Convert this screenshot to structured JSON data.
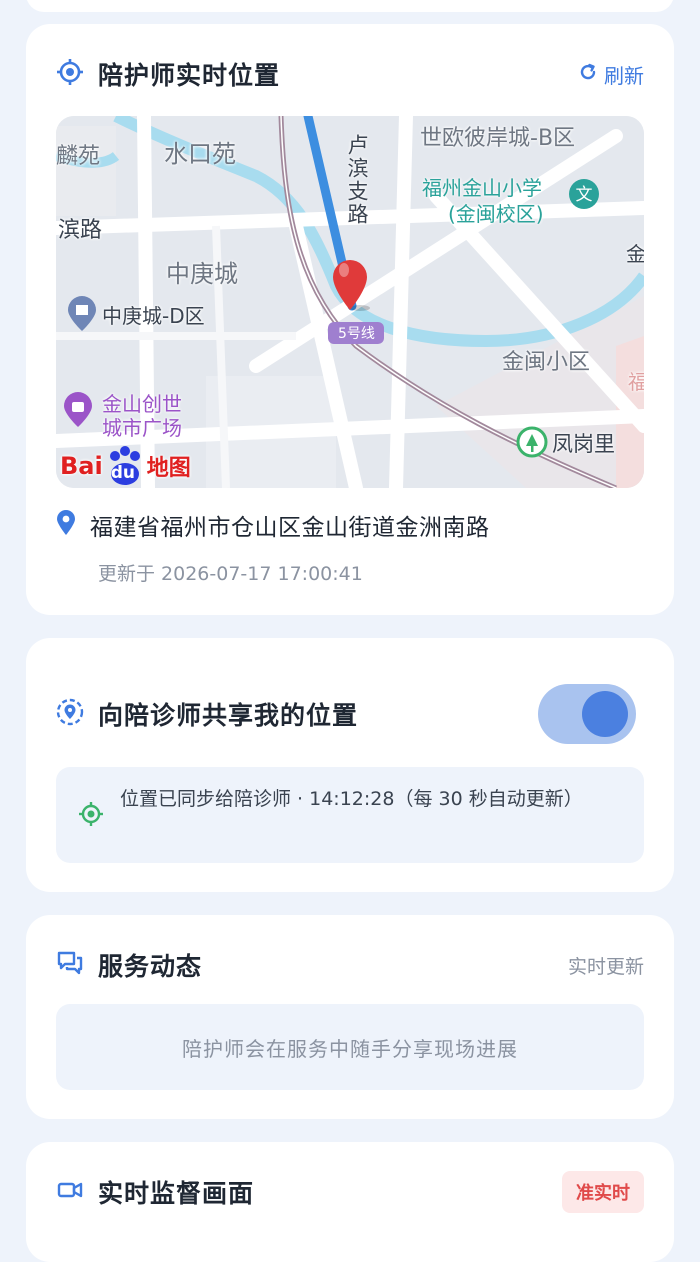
{
  "location_card": {
    "title": "陪护师实时位置",
    "refresh_label": "刷新",
    "map": {
      "labels": {
        "shuikouyuan": "水口苑",
        "linyuan": "麟苑",
        "binlu": "滨路",
        "shiou": "世欧彼岸城-B区",
        "school_1": "福州金山小学",
        "school_2": "(金闽校区)",
        "luzhi_road": "卢滨支路",
        "zhonggengcheng": "中庚城",
        "zhonggeng_d": "中庚城-D区",
        "jinmin": "金闽小区",
        "mall_1": "金山创世",
        "mall_2": "城市广场",
        "fenggangli": "凤岗里",
        "line5": "5号线",
        "edge_jin": "金",
        "edge_fu": "福"
      },
      "logo_text": "Bai",
      "logo_du": "du",
      "logo_suffix": "地图"
    },
    "address": "福建省福州市仓山区金山街道金洲南路",
    "updated": "更新于 2026-07-17 17:00:41"
  },
  "share_card": {
    "title": "向陪诊师共享我的位置",
    "toggle_on": true,
    "notice": "位置已同步给陪诊师 · 14:12:28（每 30 秒自动更新）"
  },
  "service_card": {
    "title": "服务动态",
    "status": "实时更新",
    "empty_text": "陪护师会在服务中随手分享现场进展"
  },
  "monitor_card": {
    "title": "实时监督画面",
    "badge": "准实时"
  },
  "colors": {
    "accent": "#3f7be0",
    "background": "#eef3fb",
    "badge_red": "#e04a4a",
    "green": "#3bb36b"
  }
}
